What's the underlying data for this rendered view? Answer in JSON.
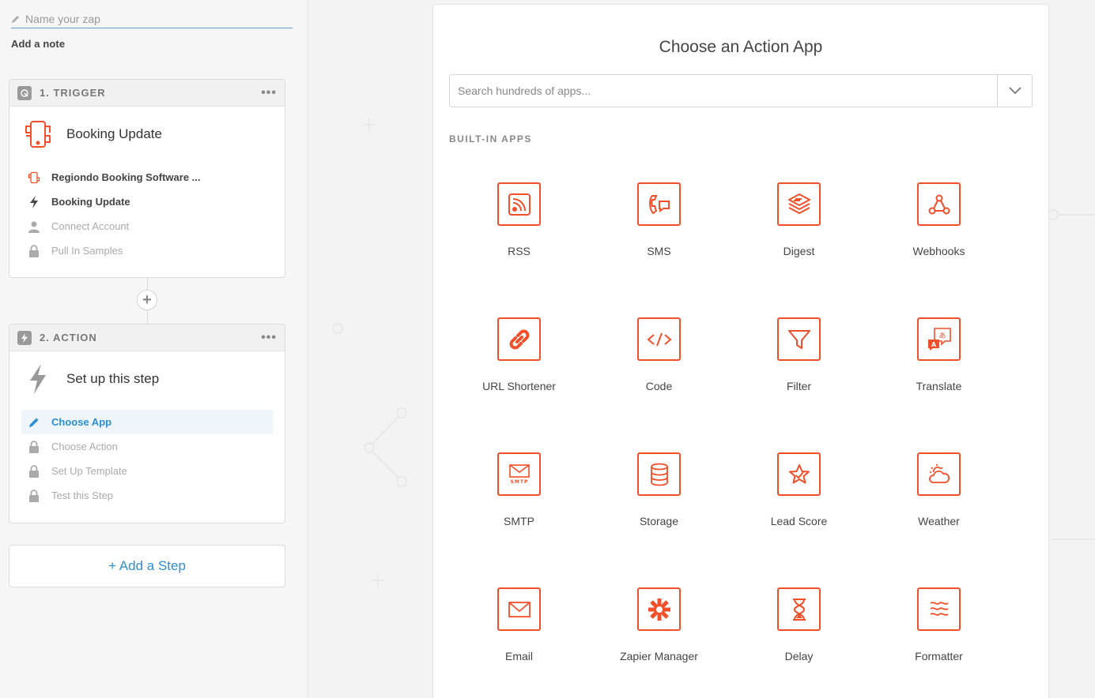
{
  "zap_name": {
    "placeholder": "Name your zap"
  },
  "add_note": "Add a note",
  "trigger": {
    "header": "1. TRIGGER",
    "title": "Booking Update",
    "items": [
      {
        "label": "Regiondo Booking Software ...",
        "icon": "regiondo-icon",
        "state": "done"
      },
      {
        "label": "Booking Update",
        "icon": "bolt-icon",
        "state": "done"
      },
      {
        "label": "Connect Account",
        "icon": "user-icon",
        "state": "muted"
      },
      {
        "label": "Pull In Samples",
        "icon": "lock-icon",
        "state": "muted"
      }
    ]
  },
  "action": {
    "header": "2. ACTION",
    "title": "Set up this step",
    "items": [
      {
        "label": "Choose App",
        "icon": "pencil-icon",
        "state": "active"
      },
      {
        "label": "Choose Action",
        "icon": "lock-icon",
        "state": "muted"
      },
      {
        "label": "Set Up Template",
        "icon": "lock-icon",
        "state": "muted"
      },
      {
        "label": "Test this Step",
        "icon": "lock-icon",
        "state": "muted"
      }
    ]
  },
  "add_step": "+ Add a Step",
  "main": {
    "title": "Choose an Action App",
    "search_placeholder": "Search hundreds of apps...",
    "section_label": "BUILT-IN APPS",
    "apps": [
      {
        "label": "RSS",
        "icon": "rss-icon"
      },
      {
        "label": "SMS",
        "icon": "sms-icon"
      },
      {
        "label": "Digest",
        "icon": "digest-icon"
      },
      {
        "label": "Webhooks",
        "icon": "webhooks-icon"
      },
      {
        "label": "URL Shortener",
        "icon": "link-icon"
      },
      {
        "label": "Code",
        "icon": "code-icon"
      },
      {
        "label": "Filter",
        "icon": "filter-icon"
      },
      {
        "label": "Translate",
        "icon": "translate-icon"
      },
      {
        "label": "SMTP",
        "icon": "smtp-icon"
      },
      {
        "label": "Storage",
        "icon": "storage-icon"
      },
      {
        "label": "Lead Score",
        "icon": "lead-score-icon"
      },
      {
        "label": "Weather",
        "icon": "weather-icon"
      },
      {
        "label": "Email",
        "icon": "email-icon"
      },
      {
        "label": "Zapier Manager",
        "icon": "zapier-manager-icon"
      },
      {
        "label": "Delay",
        "icon": "delay-icon"
      },
      {
        "label": "Formatter",
        "icon": "formatter-icon"
      }
    ],
    "smtp_badge": "SMTP",
    "translate_glyph": "あ",
    "translate_letter": "A"
  },
  "colors": {
    "accent": "#f04f2a",
    "link": "#2a8fd6",
    "muted": "#aaaaaa"
  }
}
